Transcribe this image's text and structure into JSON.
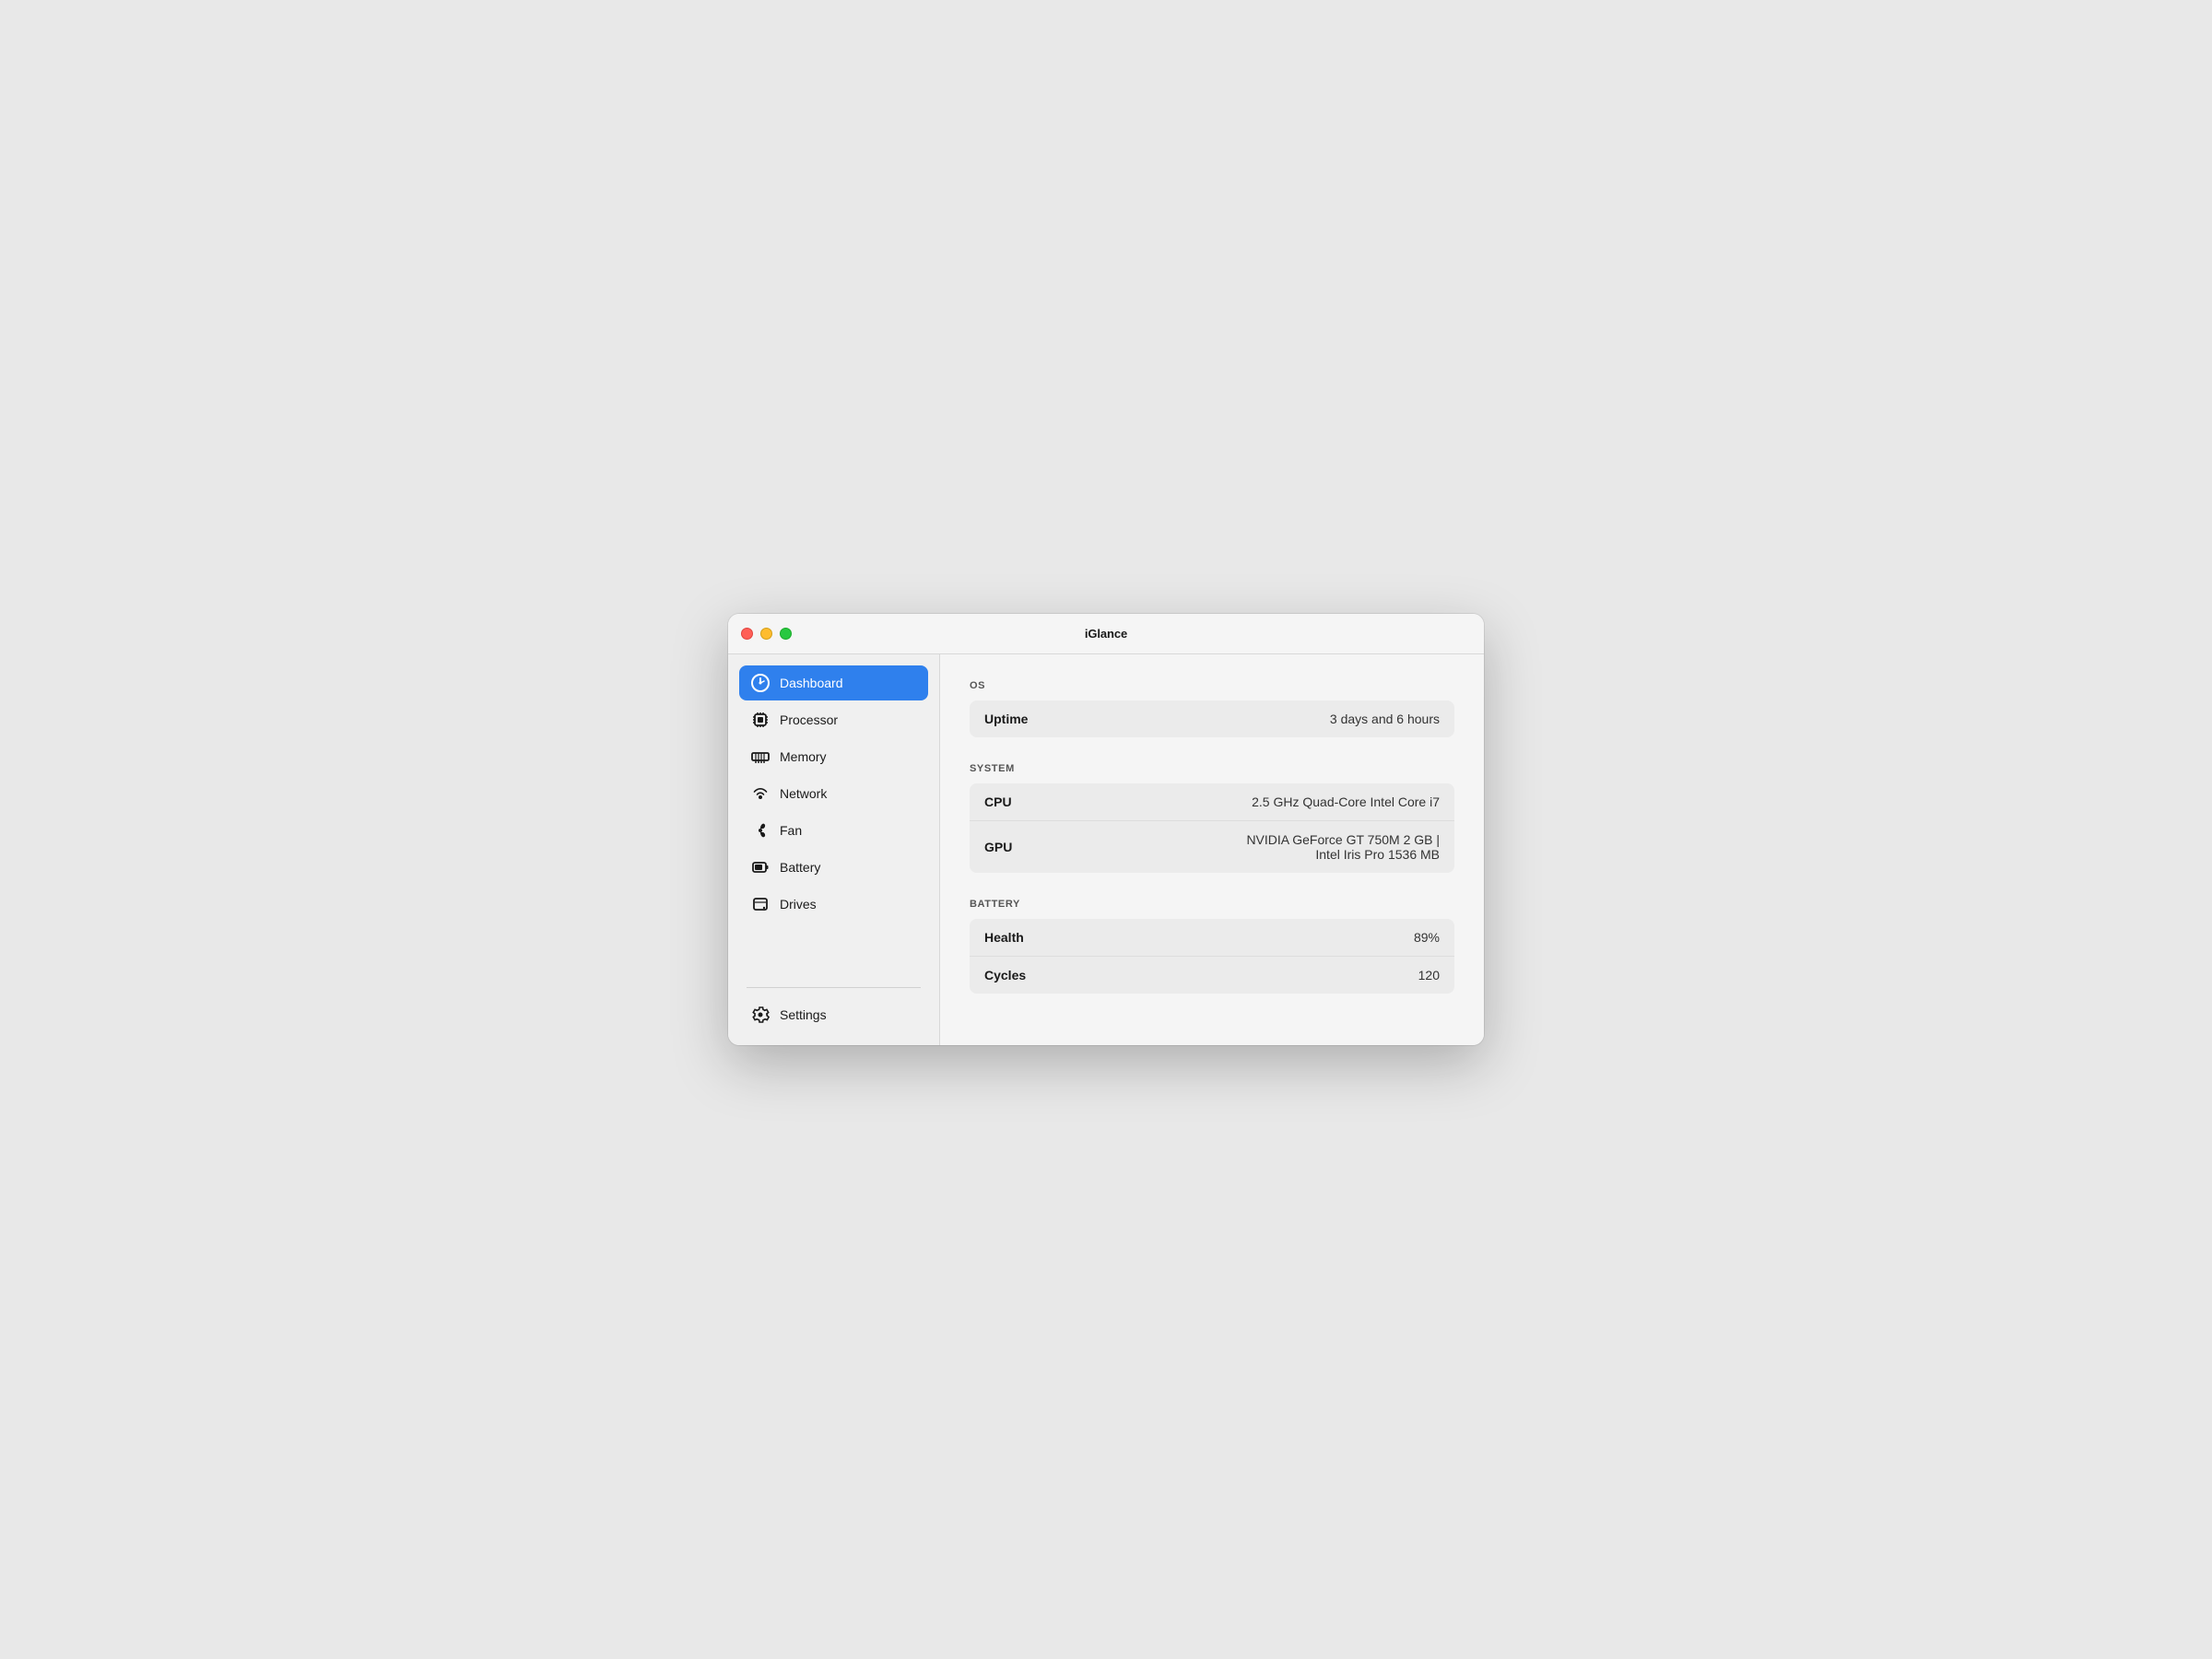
{
  "window": {
    "title": "iGlance"
  },
  "sidebar": {
    "items": [
      {
        "id": "dashboard",
        "label": "Dashboard",
        "active": true,
        "icon": "dashboard-icon"
      },
      {
        "id": "processor",
        "label": "Processor",
        "active": false,
        "icon": "processor-icon"
      },
      {
        "id": "memory",
        "label": "Memory",
        "active": false,
        "icon": "memory-icon"
      },
      {
        "id": "network",
        "label": "Network",
        "active": false,
        "icon": "network-icon"
      },
      {
        "id": "fan",
        "label": "Fan",
        "active": false,
        "icon": "fan-icon"
      },
      {
        "id": "battery",
        "label": "Battery",
        "active": false,
        "icon": "battery-icon"
      },
      {
        "id": "drives",
        "label": "Drives",
        "active": false,
        "icon": "drives-icon"
      }
    ],
    "footer": {
      "label": "Settings",
      "icon": "settings-icon"
    }
  },
  "main": {
    "sections": [
      {
        "id": "os",
        "header": "OS",
        "rows": [
          {
            "label": "Uptime",
            "value": "3 days and 6 hours"
          }
        ]
      },
      {
        "id": "system",
        "header": "SYSTEM",
        "rows": [
          {
            "label": "CPU",
            "value": "2.5 GHz Quad-Core Intel Core i7"
          },
          {
            "label": "GPU",
            "value": "NVIDIA GeForce GT 750M 2 GB |\nIntel Iris Pro 1536 MB"
          }
        ]
      },
      {
        "id": "battery",
        "header": "BATTERY",
        "rows": [
          {
            "label": "Health",
            "value": "89%"
          },
          {
            "label": "Cycles",
            "value": "120"
          }
        ]
      }
    ]
  },
  "colors": {
    "active_sidebar": "#2f80ed",
    "close_btn": "#ff5f57",
    "minimize_btn": "#febc2e",
    "maximize_btn": "#28c840"
  }
}
